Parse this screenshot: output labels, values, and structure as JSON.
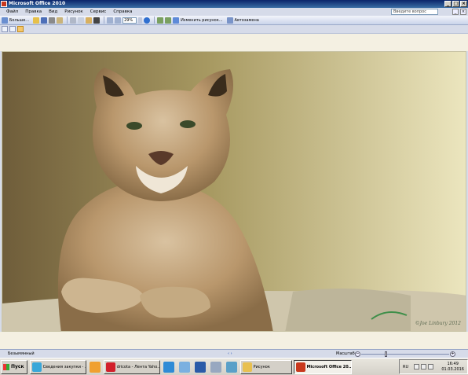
{
  "window": {
    "title": "Microsoft Office 2010",
    "controls": [
      "_",
      "□",
      "×"
    ]
  },
  "menu": [
    "Файл",
    "Правка",
    "Вид",
    "Рисунок",
    "Сервис",
    "Справка"
  ],
  "question_box": {
    "placeholder": "Введите вопрос"
  },
  "toolbar": {
    "back_label": "Больше...",
    "zoom_value": "29%",
    "edit_picture_label": "Изменить рисунок...",
    "autocorrect_label": "Автозамена"
  },
  "image": {
    "watermark": "©Joe Linbury 2012"
  },
  "status": {
    "document_name": "Безымянный",
    "nav_arrows": "‹ ›",
    "zoom_label": "Масштаб:",
    "zoom_fraction": 0.27
  },
  "taskbar": {
    "start_label": "Пуск",
    "tasks": [
      {
        "label": "Сведения закупки - ...",
        "color": "#3aa7d9"
      },
      {
        "label": "",
        "color": "#f0a030"
      },
      {
        "label": "dricota - Лента Yaho...",
        "color": "#d21f2b"
      },
      {
        "label": "",
        "color": "#2e8bd6"
      },
      {
        "label": "",
        "color": "#7ab0e0"
      },
      {
        "label": "",
        "color": "#2a5ba8"
      },
      {
        "label": "",
        "color": "#98a8c0"
      },
      {
        "label": "",
        "color": "#5aa0c8"
      },
      {
        "label": "Рисунок",
        "color": "#e8c050"
      },
      {
        "label": "Microsoft Office 20...",
        "color": "#c8381d"
      }
    ],
    "tray": {
      "lang": "RU",
      "time": "16:49",
      "date": "01.03.2016"
    }
  }
}
